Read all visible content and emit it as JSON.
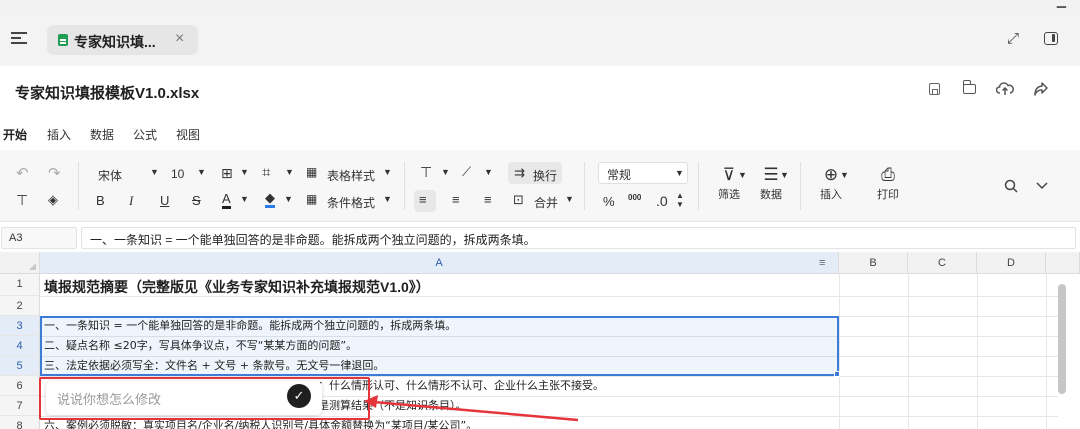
{
  "tabbar": {
    "tab_label": "专家知识填...",
    "close_glyph": "×",
    "expand_glyph": "⤢"
  },
  "file": {
    "title": "专家知识填报模板V1.0.xlsx"
  },
  "ribbon_tabs": [
    "开始",
    "插入",
    "数据",
    "公式",
    "视图"
  ],
  "toolbar": {
    "font_name": "宋体",
    "font_size": "10",
    "table_style": "表格样式",
    "conditional_format": "条件格式",
    "wrap": "换行",
    "merge": "合并",
    "number_format": "常规",
    "filter": "筛选",
    "data": "数据",
    "insert": "插入",
    "print": "打印",
    "bold": "B",
    "italic": "I",
    "underline": "U",
    "strike": "S",
    "font_color": "A",
    "percent": "%",
    "thousands": "000",
    "decimal": ".0"
  },
  "formula_bar": {
    "cell_ref": "A3",
    "content": "一、一条知识 = 一个能单独回答的是非命题。能拆成两个独立问题的，拆成两条填。"
  },
  "grid": {
    "columns": [
      "A",
      "B",
      "C",
      "D"
    ],
    "rows": [
      "1",
      "2",
      "3",
      "4",
      "5",
      "6",
      "7",
      "8"
    ],
    "cells": {
      "r1": "填报规范摘要（完整版见《业务专家知识补充填报规范V1.0》）",
      "r3": "一、一条知识 = 一个能单独回答的是非命题。能拆成两个独立问题的，拆成两条填。",
      "r4": "二、疑点名称 ≤20字，写具体争议点，不写“某某方面的问题”。",
      "r5": "三、法定依据必须写全：文件名 + 文号 + 条款号。无文号一律退回。",
      "r6_visible": "：什么情形认可、什么情形不认可、企业什么主张不接受。",
      "r7_visible": "是测算结果（不是知识条目）。",
      "r8": "六、案例必须脱敏：真实项目名/企业名/纳税人识别号/具体金额替换为“某项目/某公司”。"
    }
  },
  "ai_prompt": {
    "placeholder": "说说你想怎么修改"
  },
  "colors": {
    "accent": "#2b7de9",
    "selection": "#3d7bd9",
    "highlight": "#e5353a"
  }
}
